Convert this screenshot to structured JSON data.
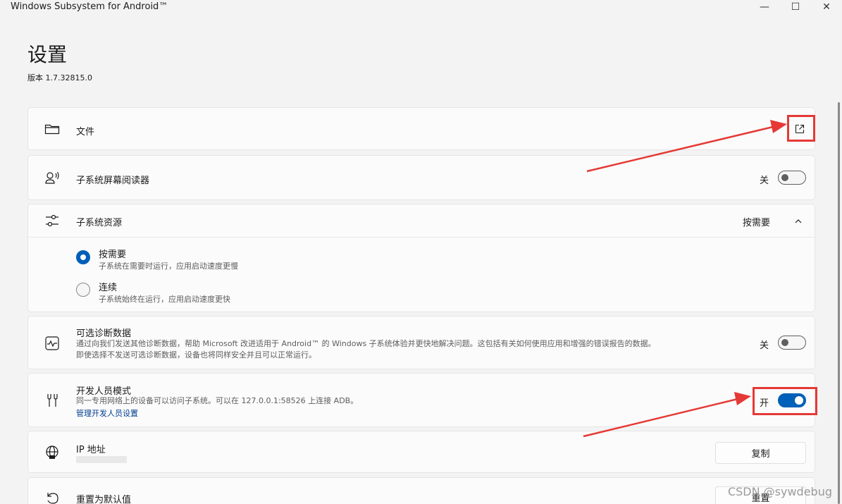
{
  "window": {
    "title": "Windows Subsystem for Android™",
    "min_glyph": "—",
    "max_glyph": "☐",
    "close_glyph": "✕"
  },
  "page": {
    "title": "设置",
    "version": "版本 1.7.32815.0"
  },
  "files": {
    "label": "文件"
  },
  "screen_reader": {
    "label": "子系统屏幕阅读器",
    "state": "关"
  },
  "resources": {
    "label": "子系统资源",
    "selected": "按需要",
    "options": [
      {
        "title": "按需要",
        "desc": "子系统在需要时运行，应用启动速度更慢"
      },
      {
        "title": "连续",
        "desc": "子系统始终在运行，应用启动速度更快"
      }
    ]
  },
  "diagnostics": {
    "label": "可选诊断数据",
    "desc1": "通过向我们发送其他诊断数据，帮助 Microsoft 改进适用于 Android™ 的 Windows 子系统体验并更快地解决问题。这包括有关如何使用应用和增强的错误报告的数据。",
    "desc2": "即使选择不发送可选诊断数据，设备也将同样安全并且可以正常运行。",
    "state": "关"
  },
  "developer": {
    "label": "开发人员模式",
    "desc": "同一专用网络上的设备可以访问子系统。可以在 127.0.0.1:58526 上连接 ADB。",
    "link": "管理开发人员设置",
    "state": "开"
  },
  "ip": {
    "label": "IP 地址",
    "button": "复制"
  },
  "reset": {
    "label": "重置为默认值",
    "button": "重置"
  },
  "watermark": "CSDN @sywdebug",
  "colors": {
    "accent": "#005fb8",
    "annotation": "#e53935"
  }
}
